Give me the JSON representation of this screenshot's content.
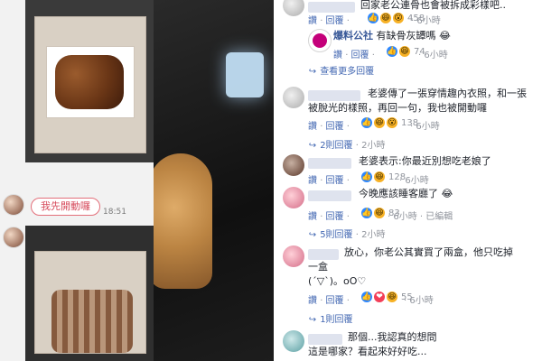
{
  "left": {
    "bubble_text": "我先開動囉",
    "bubble_time": "18:51"
  },
  "comments": [
    {
      "avatar_style": "gray",
      "text": "回家老公連骨也會被拆成彩樣吧..",
      "actions": {
        "like": "讚",
        "reply": "回覆"
      },
      "reactions": [
        "like",
        "haha",
        "wow"
      ],
      "react_count": "458",
      "time": "6小時"
    },
    {
      "is_reply": true,
      "avatar_style": "brand",
      "name": "爆料公社",
      "text": "有缺骨灰罈嗎",
      "emoji": "😂",
      "actions": {
        "like": "讚",
        "reply": "回覆"
      },
      "reactions": [
        "like",
        "haha"
      ],
      "react_count": "74",
      "time": "6小時",
      "more_replies": "查看更多回覆"
    },
    {
      "avatar_style": "gray",
      "text1": "老婆傳了一張穿情趣內衣照，和一張",
      "text2": "被脫光的樣照，再回一句，我也被開動囉",
      "actions": {
        "like": "讚",
        "reply": "回覆"
      },
      "reactions": [
        "like",
        "haha",
        "wow"
      ],
      "react_count": "138",
      "time": "6小時",
      "replies_count": "2則回覆",
      "replies_time": "2小時"
    },
    {
      "avatar_style": "brown",
      "text": "老婆表示:你最近別想吃老娘了",
      "actions": {
        "like": "讚",
        "reply": "回覆"
      },
      "reactions": [
        "like",
        "haha"
      ],
      "react_count": "128",
      "time": "6小時"
    },
    {
      "avatar_style": "pink",
      "text": "今晚應該睡客廳了",
      "emoji": "😂",
      "actions": {
        "like": "讚",
        "reply": "回覆"
      },
      "reactions": [
        "like",
        "haha"
      ],
      "react_count": "83",
      "time": "6小時",
      "edited": "已編輯",
      "replies_count": "5則回覆",
      "replies_time": "2小時"
    },
    {
      "avatar_style": "pink",
      "text1": "放心，你老公其實買了兩盒，他只吃掉",
      "text2": "一盒",
      "text3": "(´▽`)。oO♡",
      "actions": {
        "like": "讚",
        "reply": "回覆"
      },
      "reactions": [
        "like",
        "heart",
        "haha"
      ],
      "react_count": "55",
      "time": "6小時",
      "replies_count": "1則回覆"
    },
    {
      "avatar_style": "teal",
      "text1": "那個...我認真的想問",
      "text2": "這是哪家？看起來好好吃..."
    }
  ]
}
